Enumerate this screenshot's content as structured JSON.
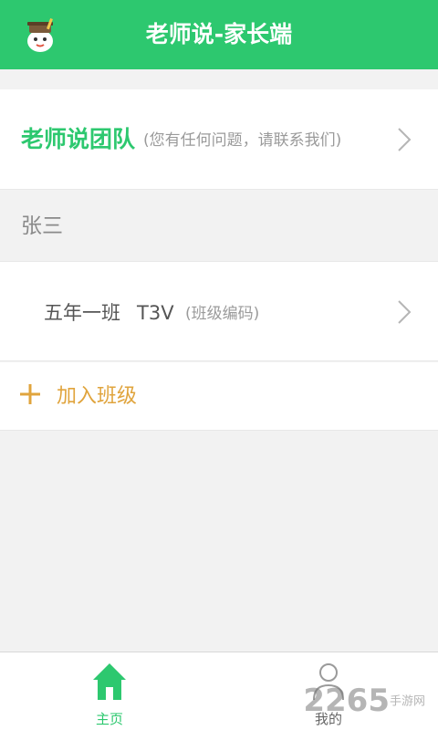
{
  "header": {
    "title": "老师说-家长端",
    "logo_icon": "teacher-mascot-icon",
    "background_color": "#2dc86f"
  },
  "team_row": {
    "name": "老师说团队",
    "hint": "(您有任何问题，请联系我们)",
    "chevron_icon": "chevron-right-icon"
  },
  "student": {
    "name": "张三"
  },
  "class_row": {
    "name": "五年一班",
    "code": "T3V",
    "code_label": "(班级编码)",
    "chevron_icon": "chevron-right-icon"
  },
  "join_row": {
    "label": "加入班级",
    "icon": "plus-icon",
    "color": "#e0a43d"
  },
  "tabbar": {
    "tabs": [
      {
        "label": "主页",
        "icon": "home-icon",
        "active": true
      },
      {
        "label": "我的",
        "icon": "user-icon",
        "active": false
      }
    ]
  },
  "watermark": {
    "brand": "2265",
    "suffix": "手游网"
  }
}
